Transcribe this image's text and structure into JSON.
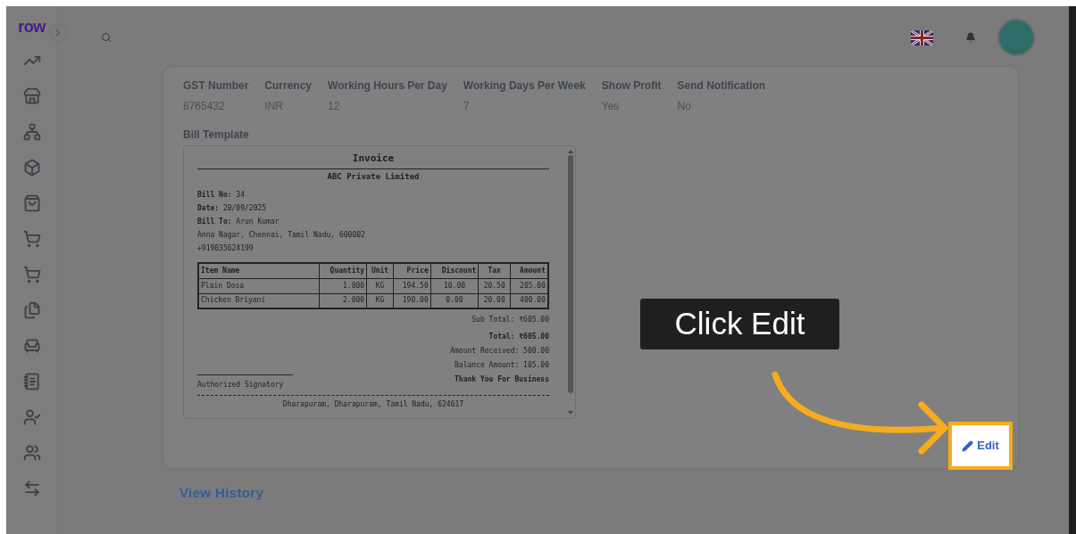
{
  "logo": "row",
  "fields": [
    {
      "label": "GST Number",
      "value": "8765432"
    },
    {
      "label": "Currency",
      "value": "INR"
    },
    {
      "label": "Working Hours Per Day",
      "value": "12"
    },
    {
      "label": "Working Days Per Week",
      "value": "7"
    },
    {
      "label": "Show Profit",
      "value": "Yes"
    },
    {
      "label": "Send Notification",
      "value": "No"
    }
  ],
  "bill_template": {
    "label": "Bill Template",
    "invoice": {
      "title": "Invoice",
      "company": "ABC Private Limited",
      "details": [
        {
          "label": "Bill No:",
          "value": "34"
        },
        {
          "label": "Date:",
          "value": "20/09/2025"
        },
        {
          "label": "Bill To:",
          "value": "Arun Kumar"
        }
      ],
      "address_lines": [
        "Anna Nagar, Chennai, Tamil Nadu, 600002",
        "+919035624199"
      ],
      "columns": [
        "Item Name",
        "Quantity",
        "Unit",
        "Price",
        "Discount",
        "Tax",
        "Amount"
      ],
      "rows": [
        [
          "Plain Dosa",
          "1.000",
          "KG",
          "194.50",
          "10.00",
          "20.50",
          "205.00"
        ],
        [
          "Chicken Briyani",
          "2.000",
          "KG",
          "190.00",
          "0.00",
          "20.00",
          "400.00"
        ]
      ],
      "totals": [
        {
          "text": "Sub Total: ₹605.00",
          "bold": false
        },
        {
          "text": "Total: ₹605.00",
          "bold": true
        },
        {
          "text": "Amount Received: 500.00",
          "bold": false
        },
        {
          "text": "Balance Amount: 105.00",
          "bold": false
        }
      ],
      "signatory": "Authorized Signatory",
      "thanks": "Thank You For Business",
      "footer": "Dharapuram, Dharapuram, Tamil Nadu, 624617"
    }
  },
  "edit_button": "Edit",
  "tooltip": "Click Edit",
  "view_history": "View History"
}
